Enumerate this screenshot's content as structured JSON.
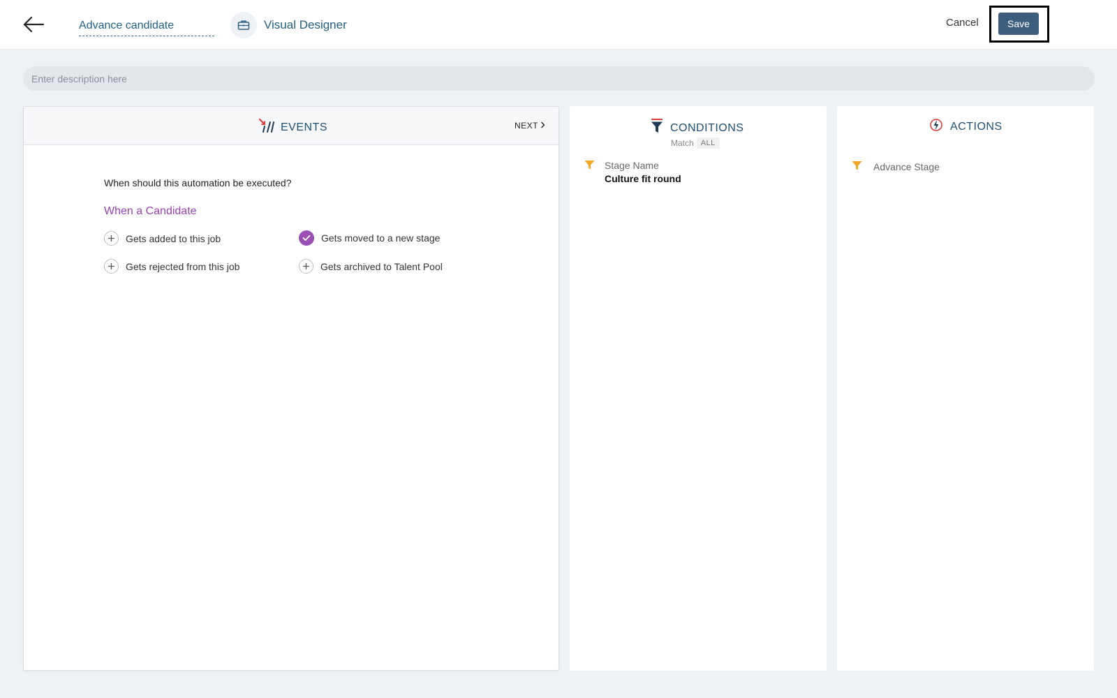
{
  "header": {
    "automation_name": "Advance candidate",
    "designer_label": "Visual Designer",
    "cancel_label": "Cancel",
    "save_label": "Save"
  },
  "description": {
    "placeholder": "Enter description here"
  },
  "events": {
    "title": "EVENTS",
    "next_label": "NEXT",
    "question": "When should this automation be executed?",
    "heading": "When a Candidate",
    "options": [
      {
        "label": "Gets added to this job",
        "checked": false
      },
      {
        "label": "Gets moved to a new stage",
        "checked": true
      },
      {
        "label": "Gets rejected from this job",
        "checked": false
      },
      {
        "label": "Gets archived to Talent Pool",
        "checked": false
      }
    ]
  },
  "conditions": {
    "title": "CONDITIONS",
    "match_label": "Match",
    "match_value": "ALL",
    "items": [
      {
        "label": "Stage Name",
        "value": "Culture fit round"
      }
    ]
  },
  "actions": {
    "title": "ACTIONS",
    "items": [
      {
        "label": "Advance Stage"
      }
    ]
  },
  "colors": {
    "accent_purple": "#9b40b5",
    "title_blue": "#1e4f72",
    "save_button": "#3d5d7c",
    "filter_icon": "#f5a623",
    "events_icon_red": "#e23b3b"
  }
}
